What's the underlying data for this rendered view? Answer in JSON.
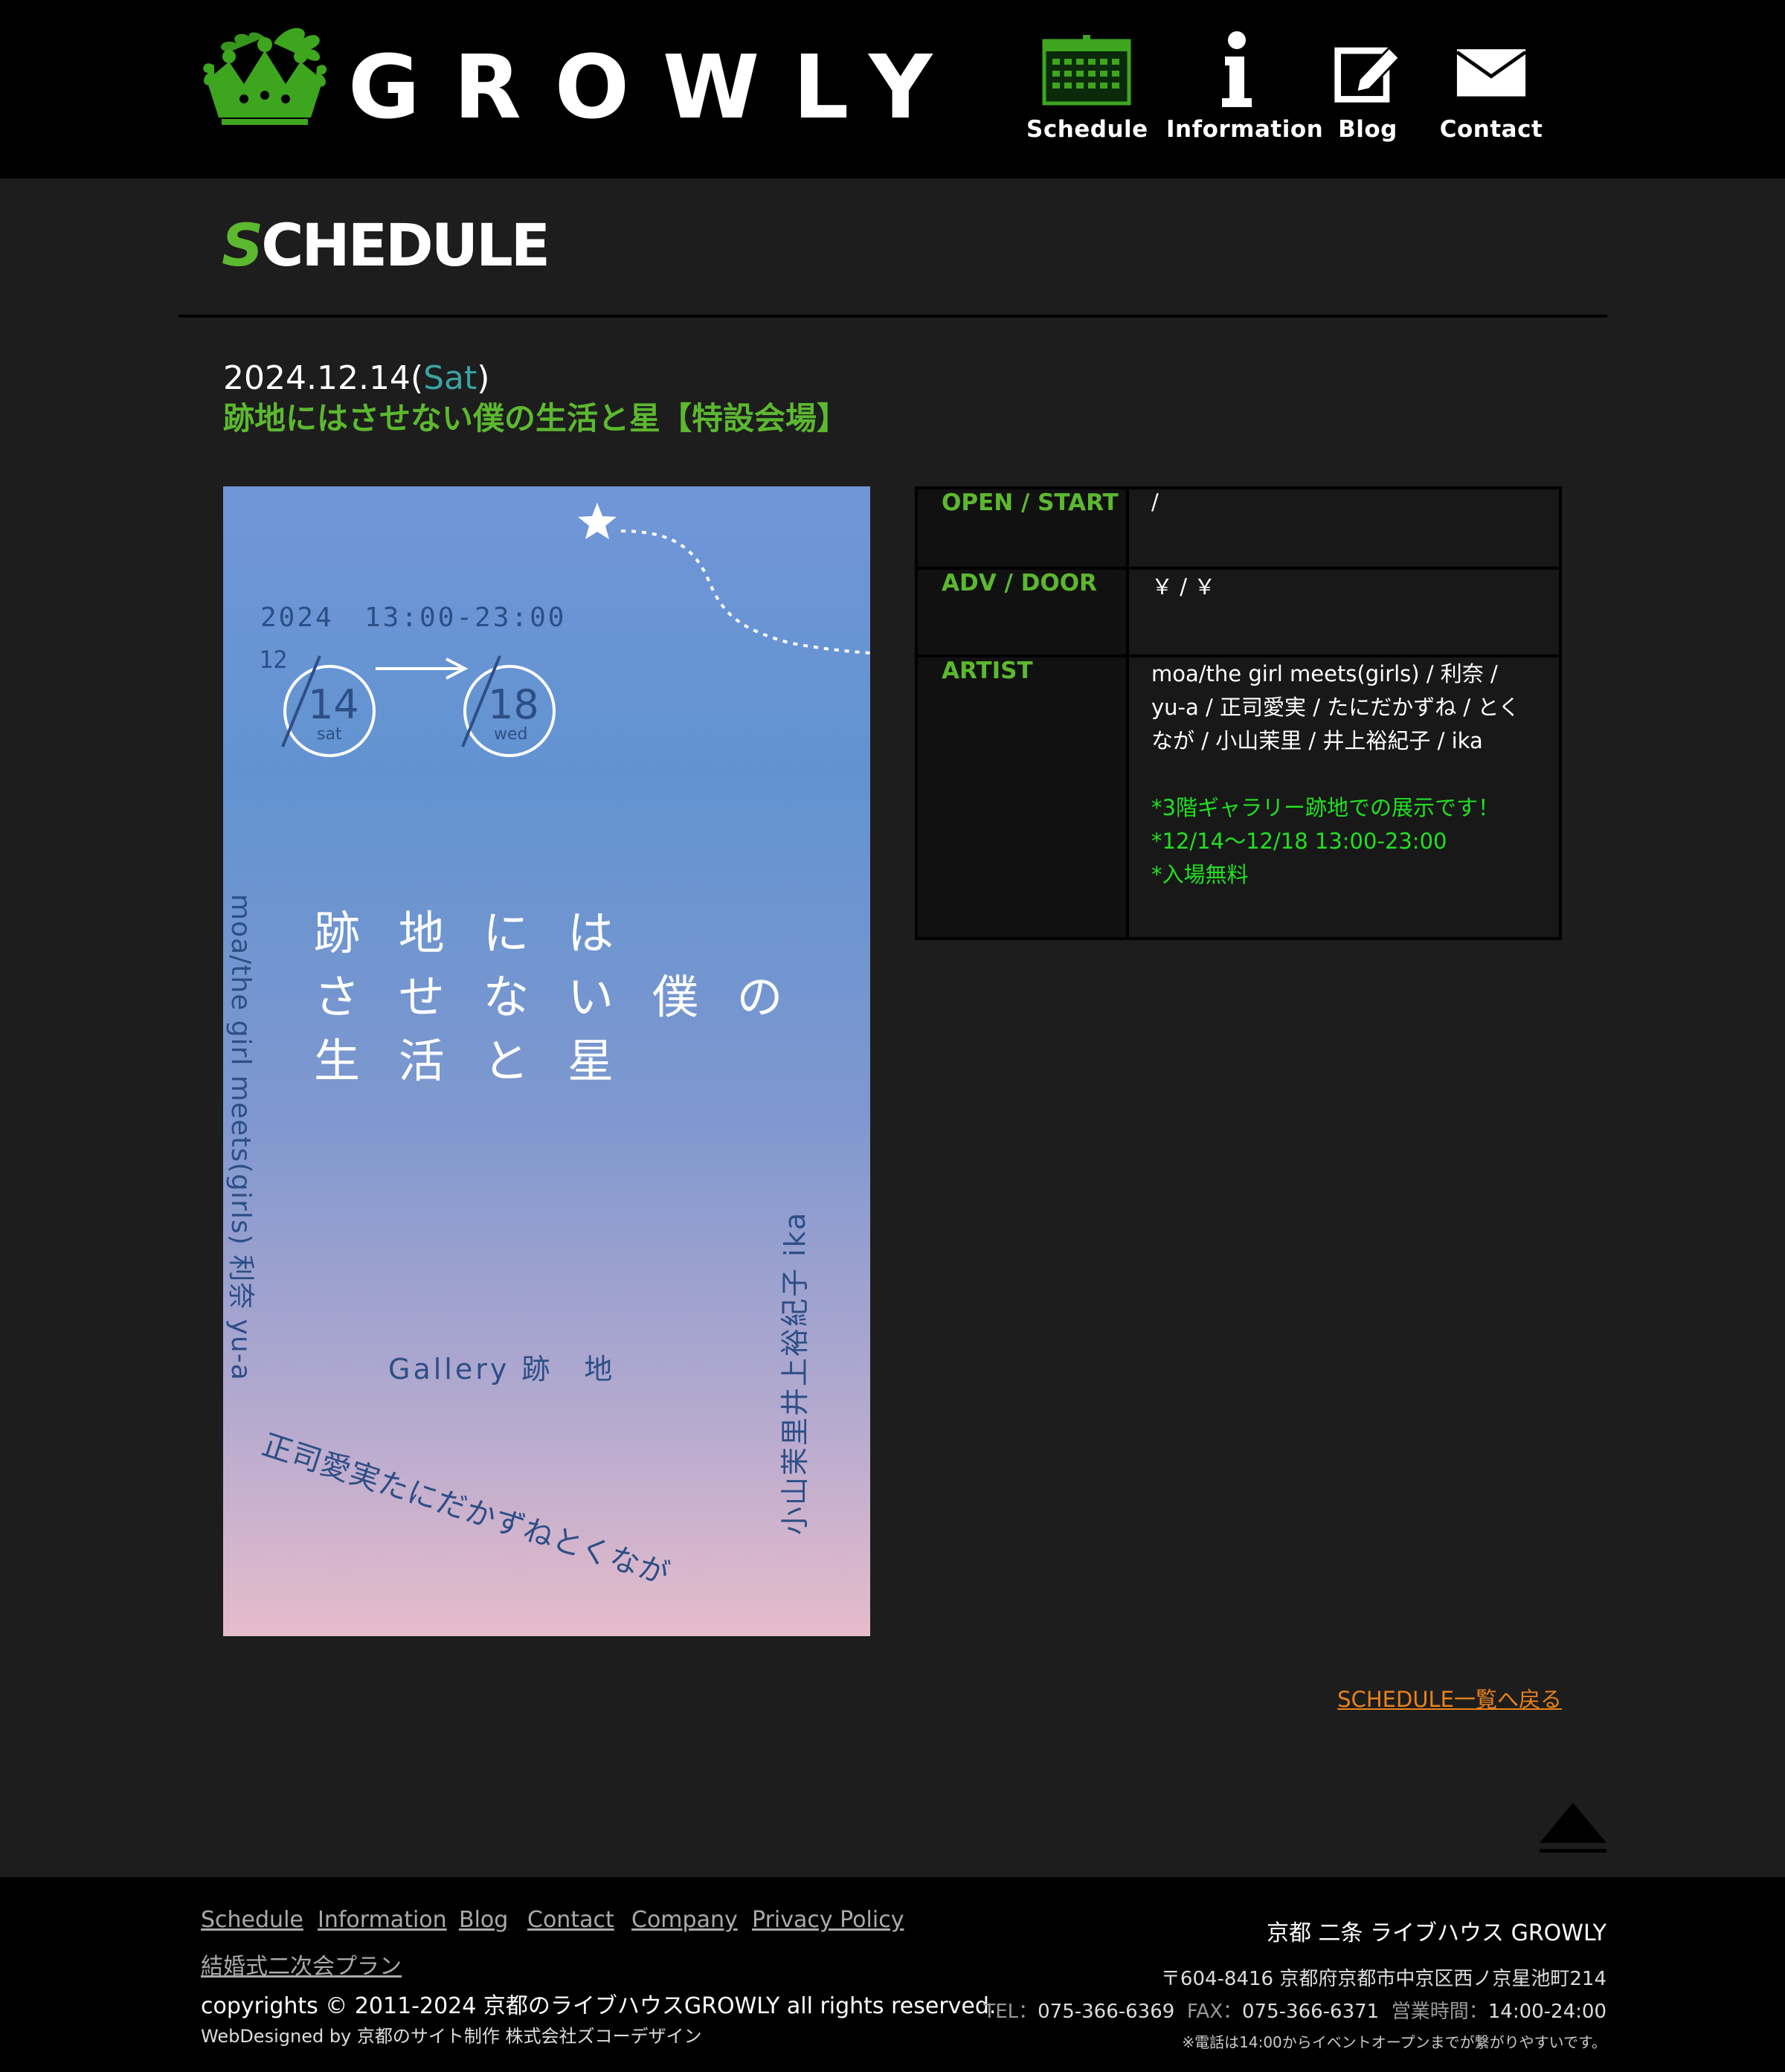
{
  "brand": {
    "name": "GROWLY"
  },
  "nav": {
    "schedule": "Schedule",
    "information": "Information",
    "blog": "Blog",
    "contact": "Contact"
  },
  "page": {
    "heading_first": "S",
    "heading_rest": "CHEDULE"
  },
  "event": {
    "date": "2024.12.14",
    "dow_open": "(",
    "dow": "Sat",
    "dow_close": ")",
    "title": "跡地にはさせない僕の生活と星【特設会場】"
  },
  "flyer": {
    "year": "2024",
    "time": "13:00-23:00",
    "month": "12",
    "start_day": "14",
    "start_dow": "sat",
    "end_day": "18",
    "end_dow": "wed",
    "title_line1": "跡 地 に は",
    "title_line2": "さ せ な い 僕 の",
    "title_line3": "生 活 と 星",
    "gallery": "Gallery 跡　地",
    "artists_left": "moa/the girl meets(girls) 利奈 yu-a",
    "artists_bottom": "正司愛実たにだかずねとくなが",
    "artists_right": "小山茉里井上裕紀子 ika"
  },
  "info": {
    "open_label": "OPEN / START",
    "open_value": " /",
    "adv_label": "ADV / DOOR",
    "adv_value": "￥ / ￥",
    "artist_label": "ARTIST",
    "artist_value": "moa/the girl meets(girls) / 利奈 / yu-a / 正司愛実 / たにだかずね / とくなが / 小山茉里 / 井上裕紀子 / ika",
    "note1": "*3階ギャラリー跡地での展示です！",
    "note2": "*12/14〜12/18 13:00-23:00",
    "note3": "*入場無料"
  },
  "back_link": "SCHEDULE一覧へ戻る",
  "footer": {
    "links": [
      "Schedule",
      "Information",
      "Blog",
      "Contact",
      "Company",
      "Privacy Policy",
      "結婚式二次会プラン"
    ],
    "copyright": "copyrights © 2011-2024 京都のライブハウスGROWLY all rights reserved.",
    "webdesign": "WebDesigned by 京都のサイト制作 株式会社ズコーデザイン",
    "venue_name": "京都 二条 ライブハウス GROWLY",
    "address": "〒604-8416 京都府京都市中京区西ノ京星池町214",
    "tel_label": "TEL：",
    "tel": "075-366-6369",
    "fax_label": "FAX：",
    "fax": "075-366-6371",
    "hours_label": "営業時間：",
    "hours": "14:00-24:00",
    "phone_note": "※電話は14:00からイベントオープンまでが繋がりやすいです。"
  },
  "colors": {
    "accent_green": "#5cb82f",
    "note_green": "#21e121",
    "link_orange": "#e8821e",
    "dow_teal": "#3aa3a3"
  }
}
